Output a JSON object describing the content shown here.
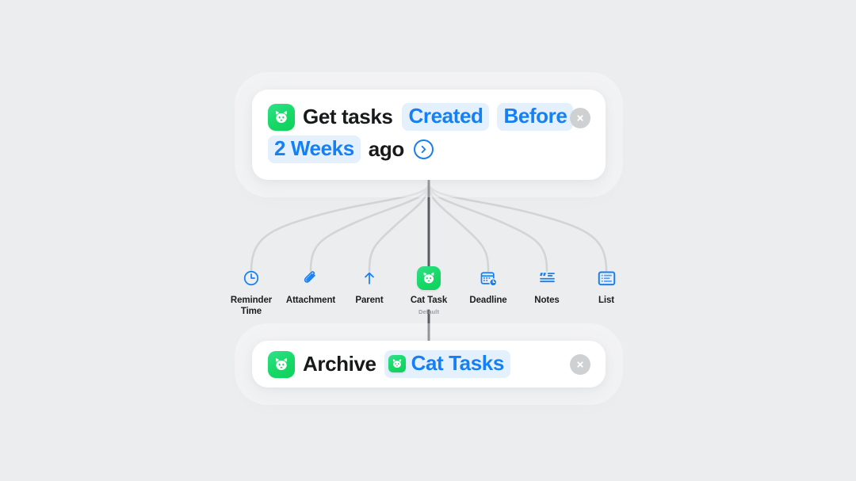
{
  "background_color": "#ecedef",
  "accent_color": "#1580f5",
  "token_bg_color": "#e4f1fd",
  "app_icon_color": "#17d866",
  "cards": {
    "get_tasks": {
      "app_icon_name": "cat-app-icon",
      "verb": "Get tasks",
      "token_field": "Created",
      "token_comparator": "Before",
      "token_duration": "2 Weeks",
      "suffix": "ago",
      "expand_icon": "chevron-right-circle-icon",
      "close_icon": "close-icon"
    },
    "archive": {
      "app_icon_name": "cat-app-icon",
      "verb": "Archive",
      "token_object": "Cat Tasks",
      "token_icon_name": "cat-app-icon",
      "close_icon": "close-icon"
    }
  },
  "parameters": [
    {
      "label": "Reminder\nTime",
      "label_line1": "Reminder",
      "label_line2": "Time",
      "icon": "clock-icon",
      "sub": ""
    },
    {
      "label": "Attachment",
      "label_line1": "Attachment",
      "label_line2": "",
      "icon": "paperclip-icon",
      "sub": ""
    },
    {
      "label": "Parent",
      "label_line1": "Parent",
      "label_line2": "",
      "icon": "arrow-up-icon",
      "sub": ""
    },
    {
      "label": "Cat Task",
      "label_line1": "Cat Task",
      "label_line2": "",
      "icon": "cat-app-icon",
      "sub": "Default"
    },
    {
      "label": "Deadline",
      "label_line1": "Deadline",
      "label_line2": "",
      "icon": "calendar-clock-icon",
      "sub": ""
    },
    {
      "label": "Notes",
      "label_line1": "Notes",
      "label_line2": "",
      "icon": "quote-lines-icon",
      "sub": ""
    },
    {
      "label": "List",
      "label_line1": "List",
      "label_line2": "",
      "icon": "list-icon",
      "sub": ""
    }
  ]
}
